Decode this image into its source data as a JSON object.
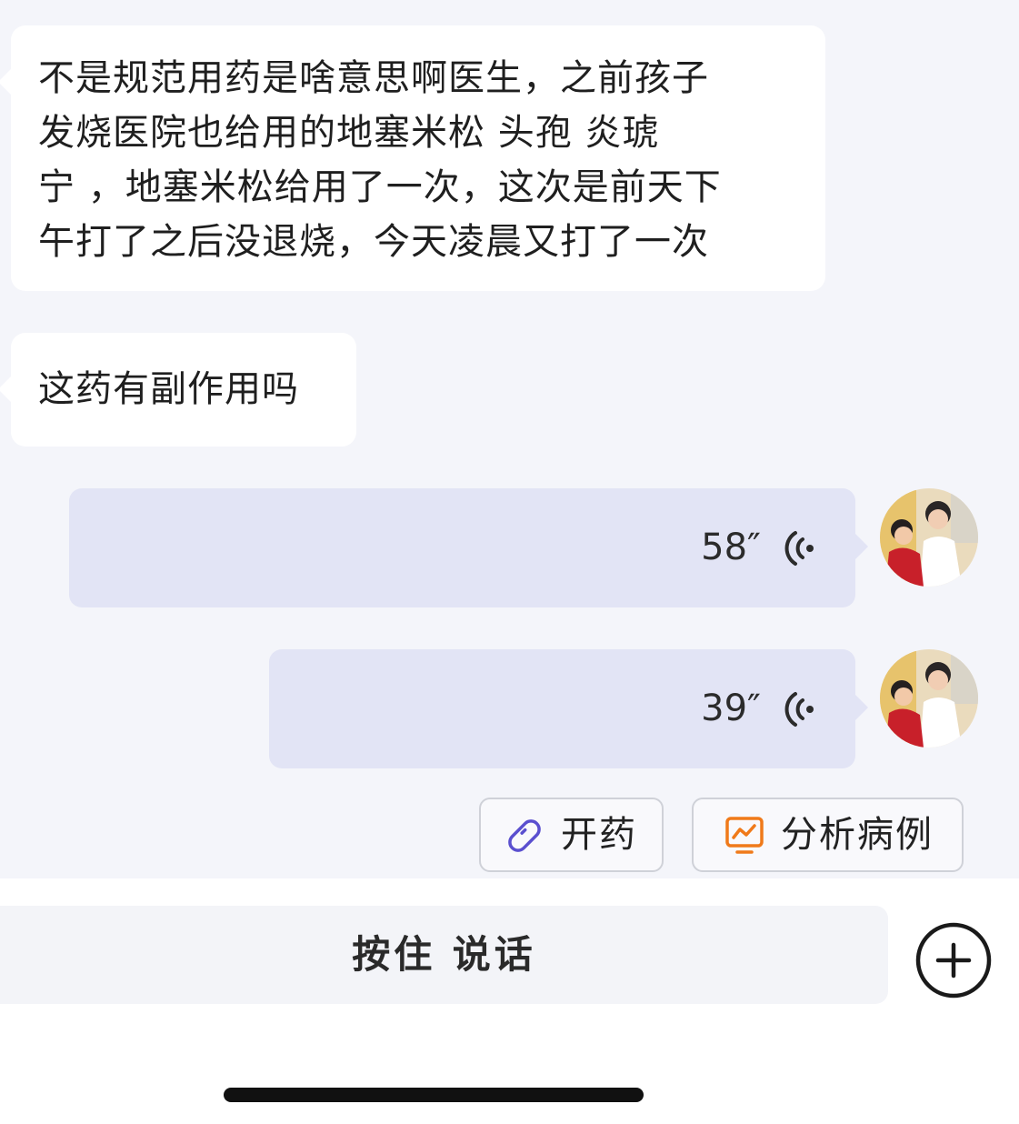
{
  "messages": {
    "incoming_1": {
      "lines": [
        "不是规范用药是啥意思啊医生，之前孩子",
        "发烧医院也给用的地塞米松 头孢  炎琥",
        "宁 ，地塞米松给用了一次，这次是前天下",
        "午打了之后没退烧，今天凌晨又打了一次"
      ]
    },
    "incoming_2": {
      "text": "这药有副作用吗"
    },
    "voice_1": {
      "duration": "58″",
      "icon": "voice-wave-icon"
    },
    "voice_2": {
      "duration": "39″",
      "icon": "voice-wave-icon"
    }
  },
  "actions": {
    "prescribe": {
      "label": "开药",
      "icon": "pill-icon",
      "color": "#5a4fcf"
    },
    "analyze_case": {
      "label": "分析病例",
      "icon": "chart-monitor-icon",
      "color": "#f07a1a"
    }
  },
  "input": {
    "hold_to_talk_label": "按住 说话",
    "plus_icon": "plus-circle-icon"
  },
  "colors": {
    "background": "#f4f5fa",
    "incoming_bubble": "#ffffff",
    "outgoing_bubble": "#e2e4f5"
  }
}
